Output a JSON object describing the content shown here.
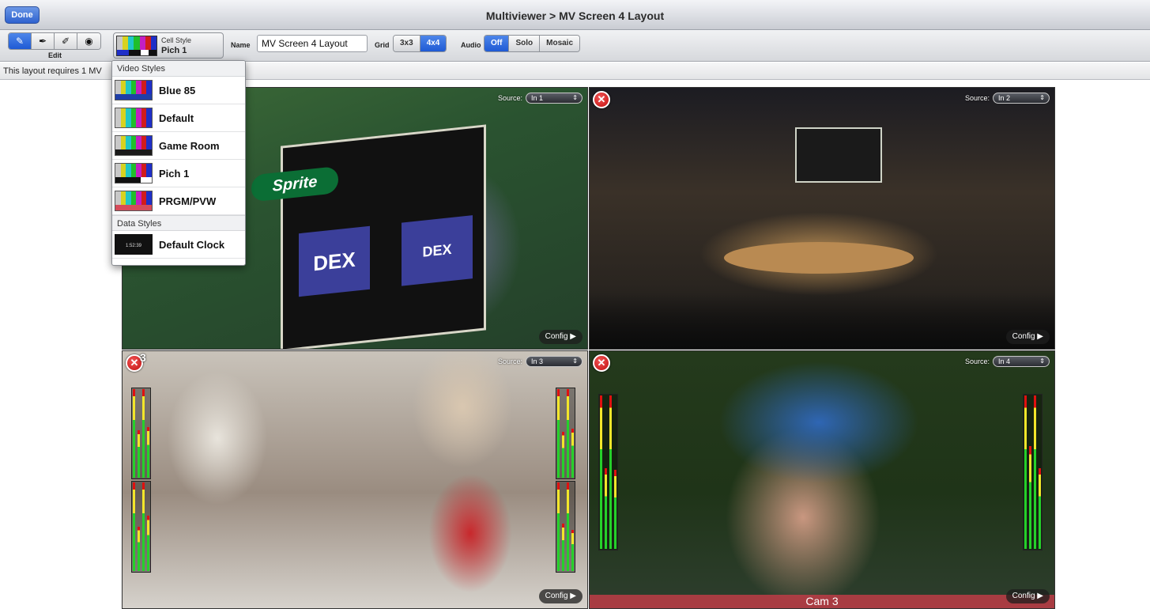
{
  "titlebar": {
    "done_label": "Done",
    "title": "Multiviewer > MV Screen 4 Layout"
  },
  "toolbar": {
    "edit_label": "Edit",
    "edit_tools": [
      {
        "icon": "pencil-icon",
        "glyph": "✎",
        "active": true
      },
      {
        "icon": "eyedropper-icon",
        "glyph": "✒",
        "active": false
      },
      {
        "icon": "brush-icon",
        "glyph": "✐",
        "active": false
      },
      {
        "icon": "eye-icon",
        "glyph": "◉",
        "active": false
      }
    ],
    "cell_style": {
      "caption": "Cell Style",
      "value": "Pich 1"
    },
    "name_label": "Name",
    "name_value": "MV Screen 4 Layout",
    "grid_label": "Grid",
    "grid_options": [
      "3x3",
      "4x4"
    ],
    "grid_selected": "4x4",
    "audio_label": "Audio",
    "audio_options": [
      "Off",
      "Solo",
      "Mosaic"
    ],
    "audio_selected": "Off"
  },
  "infobar": {
    "text": "This layout requires 1 MV"
  },
  "dropdown": {
    "video_section": "Video Styles",
    "video_items": [
      {
        "label": "Blue 85"
      },
      {
        "label": "Default"
      },
      {
        "label": "Game Room"
      },
      {
        "label": "Pich 1"
      },
      {
        "label": "PRGM/PVW"
      }
    ],
    "data_section": "Data Styles",
    "data_items": [
      {
        "label": "Default Clock",
        "thumb_time": "1:52:39"
      }
    ]
  },
  "cells": [
    {
      "source_label": "Source:",
      "source_value": "In 1",
      "config_label": "Config ▶"
    },
    {
      "source_label": "Source:",
      "source_value": "In 2",
      "config_label": "Config ▶"
    },
    {
      "source_label": "Source:",
      "source_value": "In 3",
      "config_label": "Config ▶",
      "number": "3"
    },
    {
      "source_label": "Source:",
      "source_value": "In 4",
      "config_label": "Config ▶",
      "cam_label": "Cam 3"
    }
  ],
  "scene_text": {
    "sprite": "Sprite",
    "dex": "DEX"
  },
  "colors": {
    "accent_blue": "#2e62cf",
    "close_red": "#c30f0f"
  }
}
